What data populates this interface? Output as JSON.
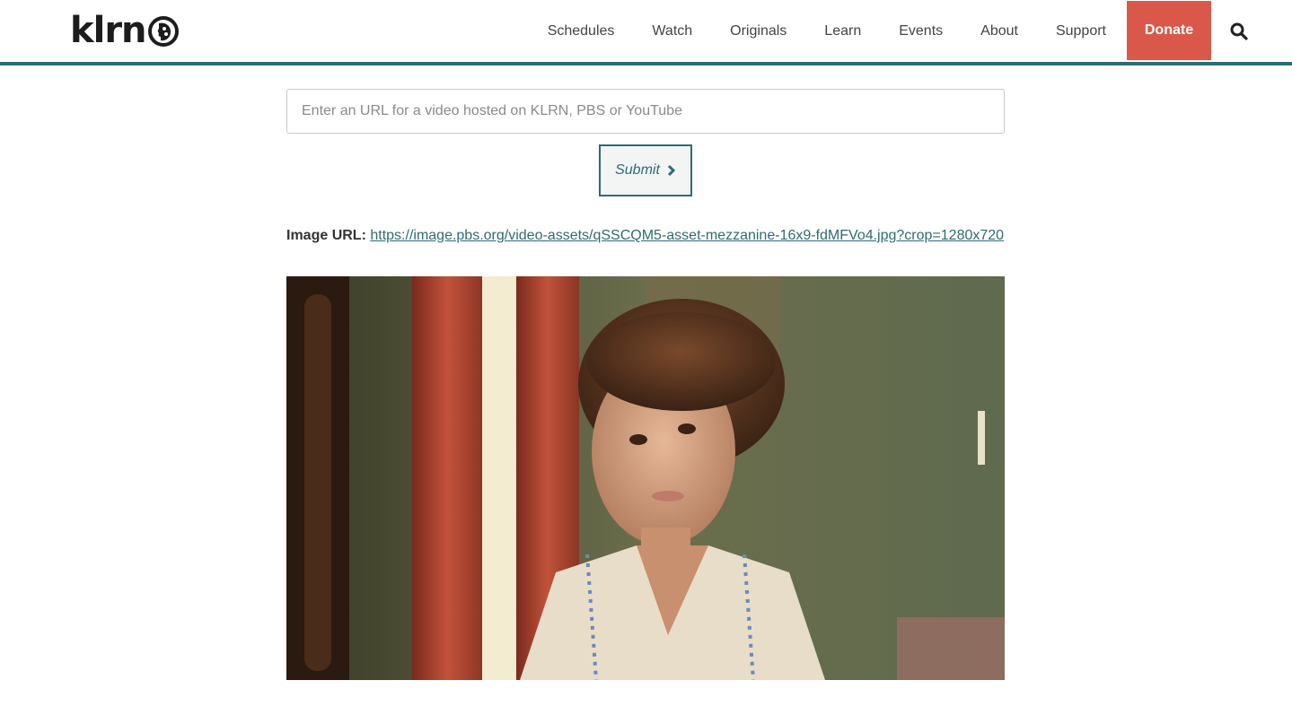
{
  "header": {
    "logo_text": "klrn",
    "nav": [
      {
        "label": "Schedules"
      },
      {
        "label": "Watch"
      },
      {
        "label": "Originals"
      },
      {
        "label": "Learn"
      },
      {
        "label": "Events"
      },
      {
        "label": "About"
      },
      {
        "label": "Support"
      }
    ],
    "donate_label": "Donate",
    "search_icon": "search-icon"
  },
  "form": {
    "url_placeholder": "Enter an URL for a video hosted on KLRN, PBS or YouTube",
    "url_value": "",
    "submit_label": "Submit",
    "submit_icon": "chevron-right-icon"
  },
  "result": {
    "image_url_label": "Image URL:",
    "image_url": "https://image.pbs.org/video-assets/qSSCQM5-asset-mezzanine-16x9-fdMFVo4.jpg?crop=1280x720"
  },
  "colors": {
    "accent": "#2e6b74",
    "donate": "#d9584a"
  }
}
